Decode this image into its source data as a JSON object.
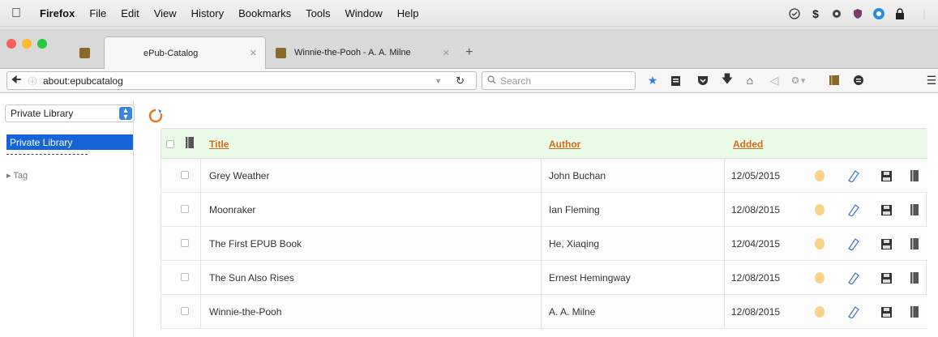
{
  "menubar": {
    "app": "Firefox",
    "items": [
      "File",
      "Edit",
      "View",
      "History",
      "Bookmarks",
      "Tools",
      "Window",
      "Help"
    ]
  },
  "tabs": [
    {
      "title": "ePub-Catalog",
      "active": true
    },
    {
      "title": "Winnie-the-Pooh - A. A. Milne",
      "active": false
    }
  ],
  "navbar": {
    "url": "about:epubcatalog",
    "search_placeholder": "Search"
  },
  "sidebar": {
    "library_select": "Private Library",
    "selected_item": "Private Library",
    "separator": "----------------",
    "tag_label": "▸ Tag"
  },
  "table": {
    "headers": {
      "title": "Title",
      "author": "Author",
      "added": "Added"
    },
    "rows": [
      {
        "title": "Grey Weather",
        "author": "John Buchan",
        "added": "12/05/2015"
      },
      {
        "title": "Moonraker",
        "author": "Ian Fleming",
        "added": "12/08/2015"
      },
      {
        "title": "The First EPUB Book",
        "author": "He, Xiaqing",
        "added": "12/04/2015"
      },
      {
        "title": "The Sun Also Rises",
        "author": "Ernest Hemingway",
        "added": "12/08/2015"
      },
      {
        "title": "Winnie-the-Pooh",
        "author": "A. A. Milne",
        "added": "12/08/2015"
      }
    ]
  },
  "colors": {
    "accent_blue": "#1565d8",
    "header_link": "#d56a1e",
    "header_bg": "#e9fae6"
  }
}
